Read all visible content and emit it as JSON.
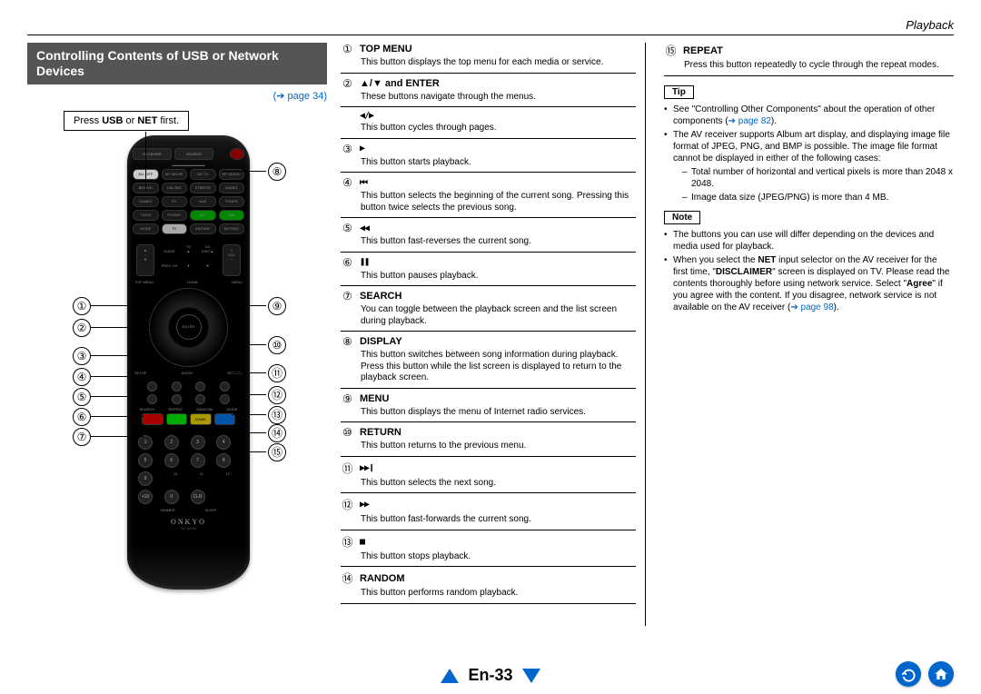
{
  "header_right": "Playback",
  "title": "Controlling Contents of USB or Network Devices",
  "page_ref": "(➔ page 34)",
  "callout_instruction_pre": "Press ",
  "callout_instruction_bold1": "USB",
  "callout_instruction_mid": " or ",
  "callout_instruction_bold2": "NET",
  "callout_instruction_post": " first.",
  "left_nums": [
    "①",
    "②",
    "③",
    "④",
    "⑤",
    "⑥",
    "⑦"
  ],
  "right_nums": [
    "⑧",
    "⑨",
    "⑩",
    "⑪",
    "⑫",
    "⑬",
    "⑭",
    "⑮"
  ],
  "items": [
    {
      "num": "①",
      "title": "TOP MENU",
      "desc": "This button displays the top menu for each media or service."
    },
    {
      "num": "②",
      "title": "▲/▼ and ENTER",
      "desc": "These buttons navigate through the menus."
    },
    {
      "num": "",
      "title": "◀/▶",
      "title_class": "icon-txt",
      "desc": "This button cycles through pages."
    },
    {
      "num": "③",
      "title": "▶",
      "title_class": "icon-txt",
      "desc": "This button starts playback."
    },
    {
      "num": "④",
      "title": "⏮",
      "title_class": "icon-txt",
      "desc": "This button selects the beginning of the current song. Pressing this button twice selects the previous song."
    },
    {
      "num": "⑤",
      "title": "◀◀",
      "title_class": "icon-txt",
      "desc": "This button fast-reverses the current song."
    },
    {
      "num": "⑥",
      "title": "❚❚",
      "title_class": "icon-txt",
      "desc": "This button pauses playback."
    },
    {
      "num": "⑦",
      "title": "SEARCH",
      "desc": "You can toggle between the playback screen and the list screen during playback."
    },
    {
      "num": "⑧",
      "title": "DISPLAY",
      "desc": "This button switches between song information during playback.\nPress this button while the list screen is displayed to return to the playback screen."
    },
    {
      "num": "⑨",
      "title": "MENU",
      "desc": "This button displays the menu of Internet radio services."
    },
    {
      "num": "⑩",
      "title": "RETURN",
      "desc": "This button returns to the previous menu."
    },
    {
      "num": "⑪",
      "title": "▶▶❙",
      "title_class": "icon-txt",
      "desc": "This button selects the next song."
    },
    {
      "num": "⑫",
      "title": "▶▶",
      "title_class": "icon-txt",
      "desc": "This button fast-forwards the current song."
    },
    {
      "num": "⑬",
      "title": "■",
      "title_class": "icon-txt",
      "desc": "This button stops playback."
    },
    {
      "num": "⑭",
      "title": "RANDOM",
      "desc": "This button performs random playback."
    }
  ],
  "right_items": [
    {
      "num": "⑮",
      "title": "REPEAT",
      "desc": "Press this button repeatedly to cycle through the repeat modes."
    }
  ],
  "tip_label": "Tip",
  "tips": [
    {
      "text": "See \"Controlling Other Components\" about the operation of other components (",
      "link": "➔ page 82",
      "after": ")."
    },
    {
      "text": "The AV receiver supports Album art display, and displaying image file format of JPEG, PNG, and BMP is possible. The image file format cannot be displayed in either of the following cases:",
      "sub": [
        "Total number of horizontal and vertical pixels is more than 2048 x 2048.",
        "Image data size (JPEG/PNG) is more than 4 MB."
      ]
    }
  ],
  "note_label": "Note",
  "notes": [
    {
      "text": "The buttons you can use will differ depending on the devices and media used for playback."
    },
    {
      "text_parts": [
        "When you select the ",
        {
          "b": "NET"
        },
        " input selector on the AV receiver for the first time, \"",
        {
          "b": "DISCLAIMER"
        },
        "\" screen is displayed on TV. Please read the contents thoroughly before using network service. Select \"",
        {
          "b": "Agree"
        },
        "\" if you agree with the content. If you disagree, network service is not available on the AV receiver (",
        {
          "link": "➔ page 98"
        },
        ")."
      ]
    }
  ],
  "remote_brand": "ONKYO",
  "page_number": "En-33",
  "chart_data": null
}
